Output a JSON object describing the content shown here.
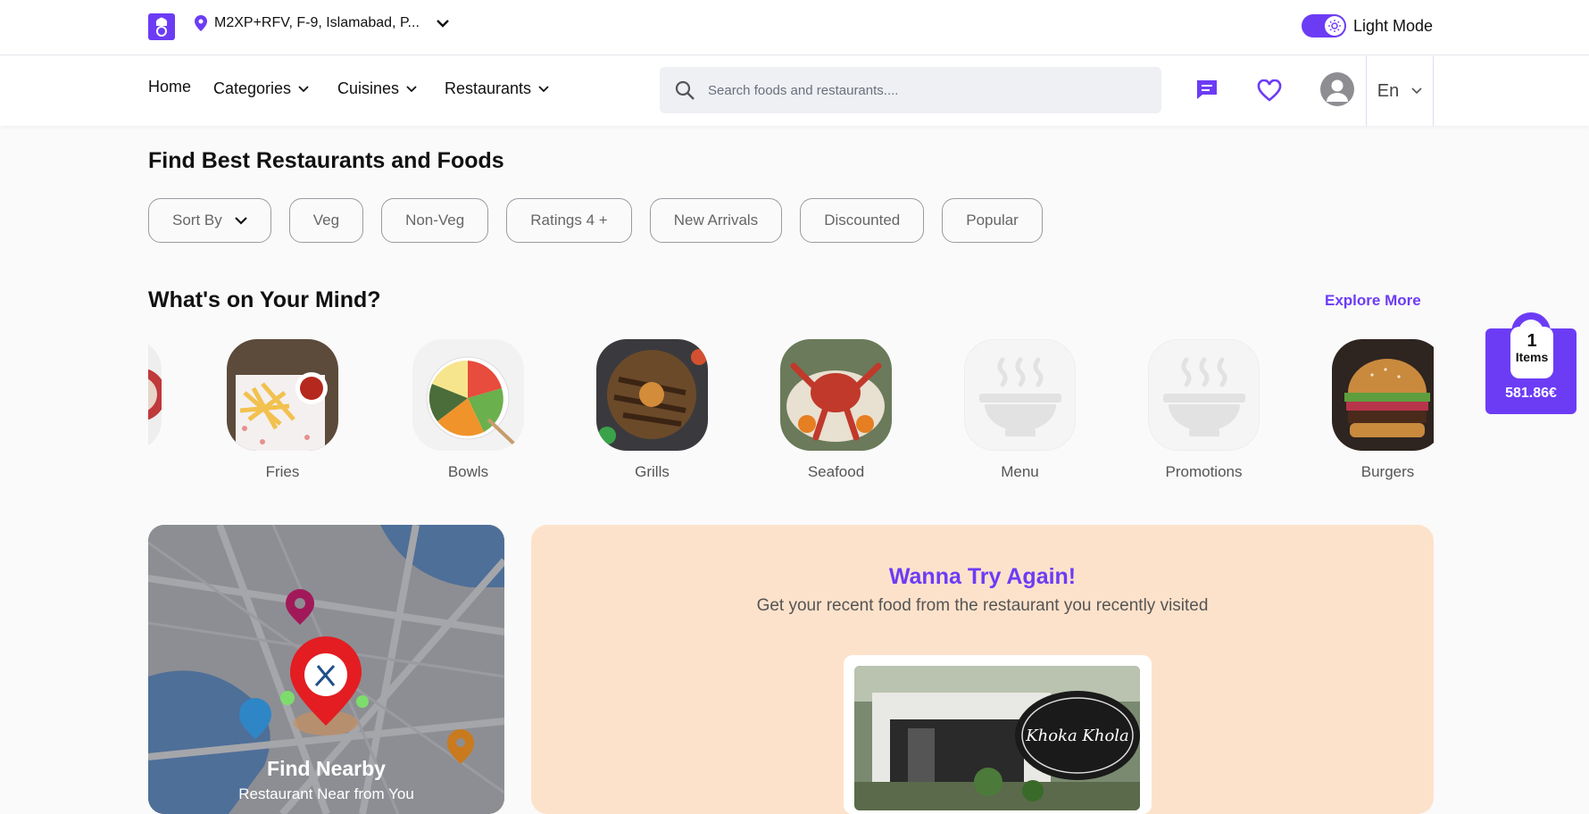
{
  "topbar": {
    "location": "M2XP+RFV, F-9, Islamabad, P...",
    "mode_label": "Light Mode"
  },
  "nav": {
    "home": "Home",
    "categories": "Categories",
    "cuisines": "Cuisines",
    "restaurants": "Restaurants",
    "search_placeholder": "Search foods and restaurants....",
    "language": "En"
  },
  "main": {
    "heading": "Find Best Restaurants and Foods",
    "filters": [
      "Sort By",
      "Veg",
      "Non-Veg",
      "Ratings 4 +",
      "New Arrivals",
      "Discounted",
      "Popular"
    ]
  },
  "mind": {
    "heading": "What's on Your Mind?",
    "explore": "Explore More",
    "categories": [
      "Fries",
      "Bowls",
      "Grills",
      "Seafood",
      "Menu",
      "Promotions",
      "Burgers"
    ]
  },
  "cart": {
    "count": "1",
    "items_label": "Items",
    "total": "581.86€"
  },
  "nearby": {
    "title": "Find Nearby",
    "subtitle": "Restaurant Near from You"
  },
  "again": {
    "title": "Wanna Try Again!",
    "subtitle": "Get your recent food from the restaurant you recently visited",
    "restaurant_sign": "Khoka Khola"
  },
  "colors": {
    "accent": "#6c3cf5",
    "peach": "#fde2cb"
  }
}
